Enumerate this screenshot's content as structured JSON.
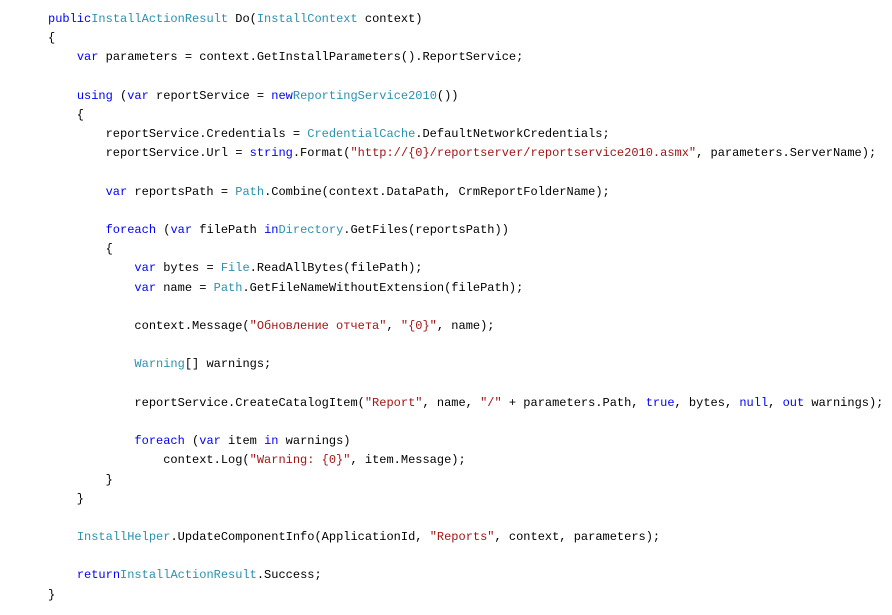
{
  "code": {
    "tokens": [
      {
        "indent": 0,
        "parts": [
          [
            "kw",
            "public"
          ],
          [
            "",
            ""
          ],
          [
            "type",
            "InstallActionResult"
          ],
          [
            "",
            " Do("
          ],
          [
            "type",
            "InstallContext"
          ],
          [
            "",
            " context)"
          ]
        ]
      },
      {
        "indent": 0,
        "parts": [
          [
            "",
            "{"
          ]
        ]
      },
      {
        "indent": 1,
        "parts": [
          [
            "kw",
            "var"
          ],
          [
            "",
            " parameters = context.GetInstallParameters().ReportService;"
          ]
        ]
      },
      {
        "indent": 0,
        "parts": [
          [
            "",
            ""
          ]
        ]
      },
      {
        "indent": 1,
        "parts": [
          [
            "kw",
            "using"
          ],
          [
            "",
            " ("
          ],
          [
            "kw",
            "var"
          ],
          [
            "",
            " reportService = "
          ],
          [
            "kw",
            "new"
          ],
          [
            "",
            ""
          ],
          [
            "type",
            "ReportingService2010"
          ],
          [
            "",
            "())"
          ]
        ]
      },
      {
        "indent": 1,
        "parts": [
          [
            "",
            "{"
          ]
        ]
      },
      {
        "indent": 2,
        "parts": [
          [
            "",
            "reportService.Credentials = "
          ],
          [
            "type",
            "CredentialCache"
          ],
          [
            "",
            ".DefaultNetworkCredentials;"
          ]
        ]
      },
      {
        "indent": 2,
        "parts": [
          [
            "",
            "reportService.Url = "
          ],
          [
            "kw",
            "string"
          ],
          [
            "",
            ".Format("
          ],
          [
            "str",
            "\"http://{0}/reportserver/reportservice2010.asmx\""
          ],
          [
            "",
            ", parameters.ServerName);"
          ]
        ]
      },
      {
        "indent": 0,
        "parts": [
          [
            "",
            ""
          ]
        ]
      },
      {
        "indent": 2,
        "parts": [
          [
            "kw",
            "var"
          ],
          [
            "",
            " reportsPath = "
          ],
          [
            "type",
            "Path"
          ],
          [
            "",
            ".Combine(context.DataPath, CrmReportFolderName);"
          ]
        ]
      },
      {
        "indent": 0,
        "parts": [
          [
            "",
            ""
          ]
        ]
      },
      {
        "indent": 2,
        "parts": [
          [
            "kw",
            "foreach"
          ],
          [
            "",
            " ("
          ],
          [
            "kw",
            "var"
          ],
          [
            "",
            " filePath "
          ],
          [
            "kw",
            "in"
          ],
          [
            "",
            ""
          ],
          [
            "type",
            "Directory"
          ],
          [
            "",
            ".GetFiles(reportsPath))"
          ]
        ]
      },
      {
        "indent": 2,
        "parts": [
          [
            "",
            "{"
          ]
        ]
      },
      {
        "indent": 3,
        "parts": [
          [
            "kw",
            "var"
          ],
          [
            "",
            " bytes = "
          ],
          [
            "type",
            "File"
          ],
          [
            "",
            ".ReadAllBytes(filePath);"
          ]
        ]
      },
      {
        "indent": 3,
        "parts": [
          [
            "kw",
            "var"
          ],
          [
            "",
            " name = "
          ],
          [
            "type",
            "Path"
          ],
          [
            "",
            ".GetFileNameWithoutExtension(filePath);"
          ]
        ]
      },
      {
        "indent": 0,
        "parts": [
          [
            "",
            ""
          ]
        ]
      },
      {
        "indent": 3,
        "parts": [
          [
            "",
            "context.Message("
          ],
          [
            "str",
            "\"Обновление отчета\""
          ],
          [
            "",
            ", "
          ],
          [
            "str",
            "\"{0}\""
          ],
          [
            "",
            ", name);"
          ]
        ]
      },
      {
        "indent": 0,
        "parts": [
          [
            "",
            ""
          ]
        ]
      },
      {
        "indent": 3,
        "parts": [
          [
            "type",
            "Warning"
          ],
          [
            "",
            "[] warnings;"
          ]
        ]
      },
      {
        "indent": 0,
        "parts": [
          [
            "",
            ""
          ]
        ]
      },
      {
        "indent": 3,
        "parts": [
          [
            "",
            "reportService.CreateCatalogItem("
          ],
          [
            "str",
            "\"Report\""
          ],
          [
            "",
            ", name, "
          ],
          [
            "str",
            "\"/\""
          ],
          [
            "",
            " + parameters.Path, "
          ],
          [
            "kw",
            "true"
          ],
          [
            "",
            ", bytes, "
          ],
          [
            "kw",
            "null"
          ],
          [
            "",
            ", "
          ],
          [
            "kw",
            "out"
          ],
          [
            "",
            " warnings);"
          ]
        ]
      },
      {
        "indent": 0,
        "parts": [
          [
            "",
            ""
          ]
        ]
      },
      {
        "indent": 3,
        "parts": [
          [
            "kw",
            "foreach"
          ],
          [
            "",
            " ("
          ],
          [
            "kw",
            "var"
          ],
          [
            "",
            " item "
          ],
          [
            "kw",
            "in"
          ],
          [
            "",
            " warnings)"
          ]
        ]
      },
      {
        "indent": 4,
        "parts": [
          [
            "",
            "context.Log("
          ],
          [
            "str",
            "\"Warning: {0}\""
          ],
          [
            "",
            ", item.Message);"
          ]
        ]
      },
      {
        "indent": 2,
        "parts": [
          [
            "",
            "}"
          ]
        ]
      },
      {
        "indent": 1,
        "parts": [
          [
            "",
            "}"
          ]
        ]
      },
      {
        "indent": 0,
        "parts": [
          [
            "",
            ""
          ]
        ]
      },
      {
        "indent": 1,
        "parts": [
          [
            "type",
            "InstallHelper"
          ],
          [
            "",
            ".UpdateComponentInfo(ApplicationId, "
          ],
          [
            "str",
            "\"Reports\""
          ],
          [
            "",
            ", context, parameters);"
          ]
        ]
      },
      {
        "indent": 0,
        "parts": [
          [
            "",
            ""
          ]
        ]
      },
      {
        "indent": 1,
        "parts": [
          [
            "kw",
            "return"
          ],
          [
            "",
            ""
          ],
          [
            "type",
            "InstallActionResult"
          ],
          [
            "",
            ".Success;"
          ]
        ]
      },
      {
        "indent": 0,
        "parts": [
          [
            "",
            "}"
          ]
        ]
      }
    ]
  }
}
